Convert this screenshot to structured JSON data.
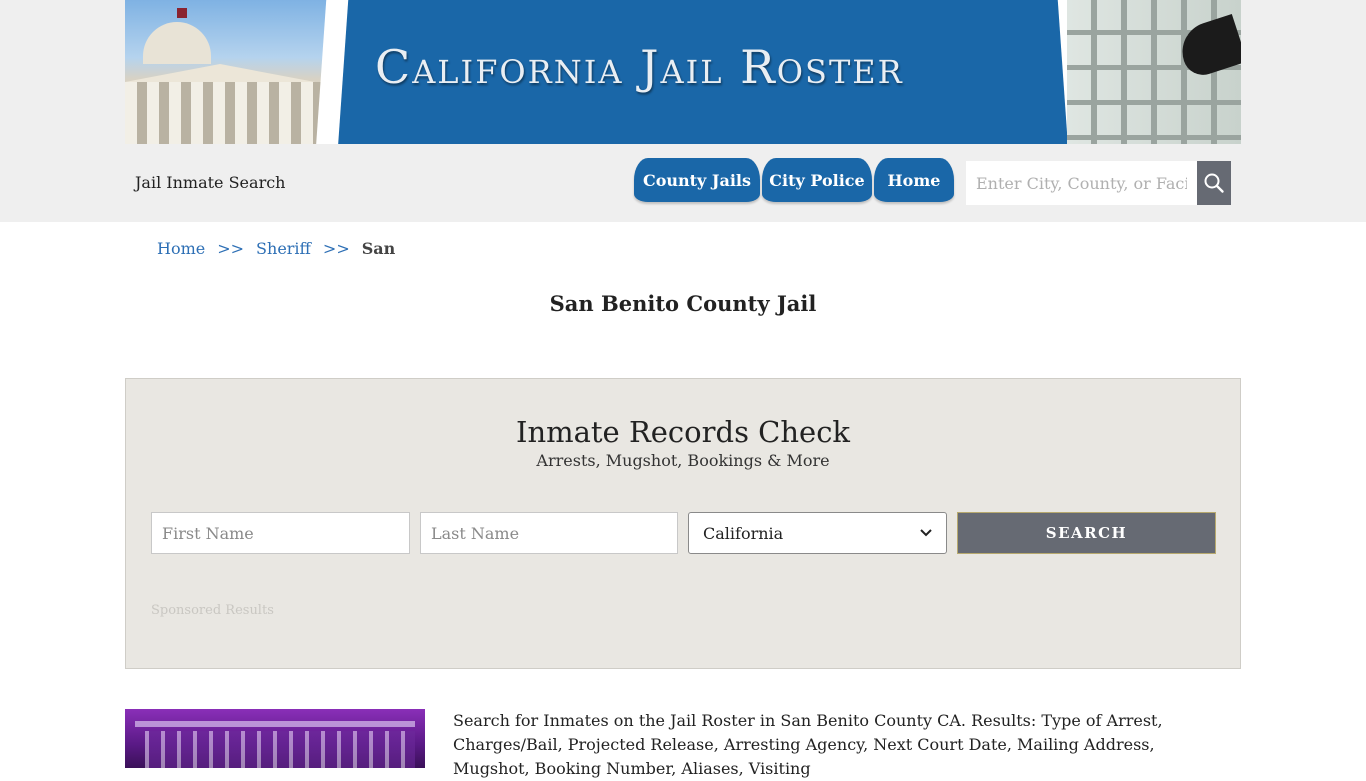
{
  "banner": {
    "title": "California Jail Roster"
  },
  "header": {
    "site_label": "Jail Inmate Search",
    "nav": [
      "County Jails",
      "City Police",
      "Home"
    ],
    "search_placeholder": "Enter City, County, or Facility",
    "search_icon": "search-icon"
  },
  "breadcrumb": {
    "home": "Home",
    "sep": ">>",
    "sheriff": "Sheriff",
    "current": "San"
  },
  "page_title": "San Benito County Jail",
  "records": {
    "title": "Inmate Records Check",
    "subtitle": "Arrests, Mugshot, Bookings & More",
    "first_name_placeholder": "First Name",
    "last_name_placeholder": "Last Name",
    "state_selected": "California",
    "search_label": "SEARCH",
    "sponsored": "Sponsored Results"
  },
  "description": "Search for Inmates on the Jail Roster in San Benito County CA. Results: Type of Arrest, Charges/Bail, Projected Release, Arresting Agency, Next Court Date, Mailing Address, Mugshot, Booking Number, Aliases, Visiting"
}
